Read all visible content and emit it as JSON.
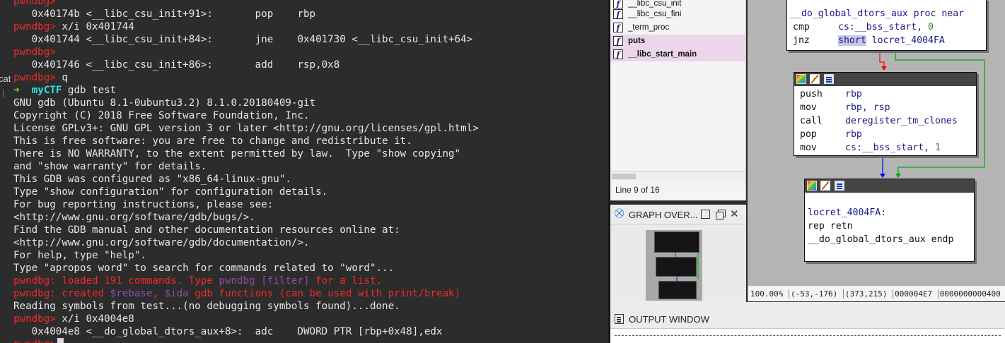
{
  "terminal": {
    "lines": [
      {
        "kind": "prompt",
        "prompt": "pwndbg>",
        "cmd": ""
      },
      {
        "kind": "asm",
        "text": "   0x40174b <__libc_csu_init+91>:       pop    rbp"
      },
      {
        "kind": "prompt",
        "prompt": "pwndbg>",
        "cmd": " x/i 0x401744"
      },
      {
        "kind": "asm",
        "text": "   0x401744 <__libc_csu_init+84>:       jne    0x401730 <__libc_csu_init+64>"
      },
      {
        "kind": "prompt",
        "prompt": "pwndbg>",
        "cmd": ""
      },
      {
        "kind": "asm",
        "text": "   0x401746 <__libc_csu_init+86>:       add    rsp,0x8"
      },
      {
        "kind": "prompt",
        "prompt": "pwndbg>",
        "cmd": " q"
      },
      {
        "kind": "shell",
        "arrow": "➜",
        "dir": "myCTF",
        "cmd": " gdb test"
      },
      {
        "kind": "text",
        "text": "GNU gdb (Ubuntu 8.1-0ubuntu3.2) 8.1.0.20180409-git"
      },
      {
        "kind": "text",
        "text": "Copyright (C) 2018 Free Software Foundation, Inc."
      },
      {
        "kind": "text",
        "text": "License GPLv3+: GNU GPL version 3 or later <http://gnu.org/licenses/gpl.html>"
      },
      {
        "kind": "text",
        "text": "This is free software: you are free to change and redistribute it."
      },
      {
        "kind": "text",
        "text": "There is NO WARRANTY, to the extent permitted by law.  Type \"show copying\""
      },
      {
        "kind": "text",
        "text": "and \"show warranty\" for details."
      },
      {
        "kind": "text",
        "text": "This GDB was configured as \"x86_64-linux-gnu\"."
      },
      {
        "kind": "text",
        "text": "Type \"show configuration\" for configuration details."
      },
      {
        "kind": "text",
        "text": "For bug reporting instructions, please see:"
      },
      {
        "kind": "text",
        "text": "<http://www.gnu.org/software/gdb/bugs/>."
      },
      {
        "kind": "text",
        "text": "Find the GDB manual and other documentation resources online at:"
      },
      {
        "kind": "text",
        "text": "<http://www.gnu.org/software/gdb/documentation/>."
      },
      {
        "kind": "text",
        "text": "For help, type \"help\"."
      },
      {
        "kind": "text",
        "text": "Type \"apropos word\" to search for commands related to \"word\"..."
      },
      {
        "kind": "red",
        "parts": [
          "pwndbg: loaded 191 commands. Type ",
          "pwndbg [filter]",
          " for a list."
        ]
      },
      {
        "kind": "red",
        "parts": [
          "pwndbg: created ",
          "$rebase",
          ", ",
          "$ida",
          " gdb functions (can be used with print/break)"
        ]
      },
      {
        "kind": "text",
        "text": "Reading symbols from test...(no debugging symbols found)...done."
      },
      {
        "kind": "prompt",
        "prompt": "pwndbg>",
        "cmd": " x/i 0x4004e8"
      },
      {
        "kind": "asm",
        "text": "   0x4004e8 <__do_global_dtors_aux+8>:  adc    DWORD PTR [rbp+0x48],edx"
      },
      {
        "kind": "prompt",
        "prompt": "pwndbg>",
        "cmd": "",
        "cursor": true
      }
    ],
    "left_edge_text": "cat"
  },
  "function_list": {
    "items": [
      {
        "name": "__libc_csu_init",
        "highlighted": false
      },
      {
        "name": "__libc_csu_fini",
        "highlighted": false
      },
      {
        "name": "_term_proc",
        "highlighted": false
      },
      {
        "name": "puts",
        "highlighted": true
      },
      {
        "name": "__libc_start_main",
        "highlighted": true
      }
    ],
    "status": "Line 9 of 16"
  },
  "graph_overview": {
    "title": "GRAPH OVER..."
  },
  "graph": {
    "nodes": {
      "top": {
        "rows": [
          {
            "type": "label",
            "text": "__do_global_dtors_aux proc near"
          },
          {
            "type": "instr",
            "mn": "cmp",
            "op": "cs:__bss_start, ",
            "num": "0"
          },
          {
            "type": "instr",
            "mn": "jnz",
            "op_hl": "short",
            "op": " locret_4004FA"
          }
        ]
      },
      "mid": {
        "rows": [
          {
            "type": "instr",
            "mn": "push",
            "op": "rbp"
          },
          {
            "type": "instr",
            "mn": "mov",
            "op": "rbp, rsp"
          },
          {
            "type": "instr",
            "mn": "call",
            "op": "deregister_tm_clones"
          },
          {
            "type": "instr",
            "mn": "pop",
            "op": "rbp"
          },
          {
            "type": "instr",
            "mn": "mov",
            "op": "cs:__bss_start, ",
            "num": "1"
          }
        ]
      },
      "bottom": {
        "rows": [
          {
            "type": "label",
            "text": "locret_4004FA:"
          },
          {
            "type": "plain",
            "text": "rep retn"
          },
          {
            "type": "plain",
            "text": "__do_global_dtors_aux endp"
          }
        ]
      }
    },
    "edge_colors": {
      "false_branch": "#ff0000",
      "true_branch": "#00aa00",
      "unconditional": "#0000ff"
    }
  },
  "graph_status": {
    "zoom": "100.00%",
    "mouse": "(-53,-176)",
    "pos": "(373,215)",
    "offset": "000004E7",
    "address": "0000000000400"
  },
  "output_window": {
    "title": "OUTPUT WINDOW"
  }
}
